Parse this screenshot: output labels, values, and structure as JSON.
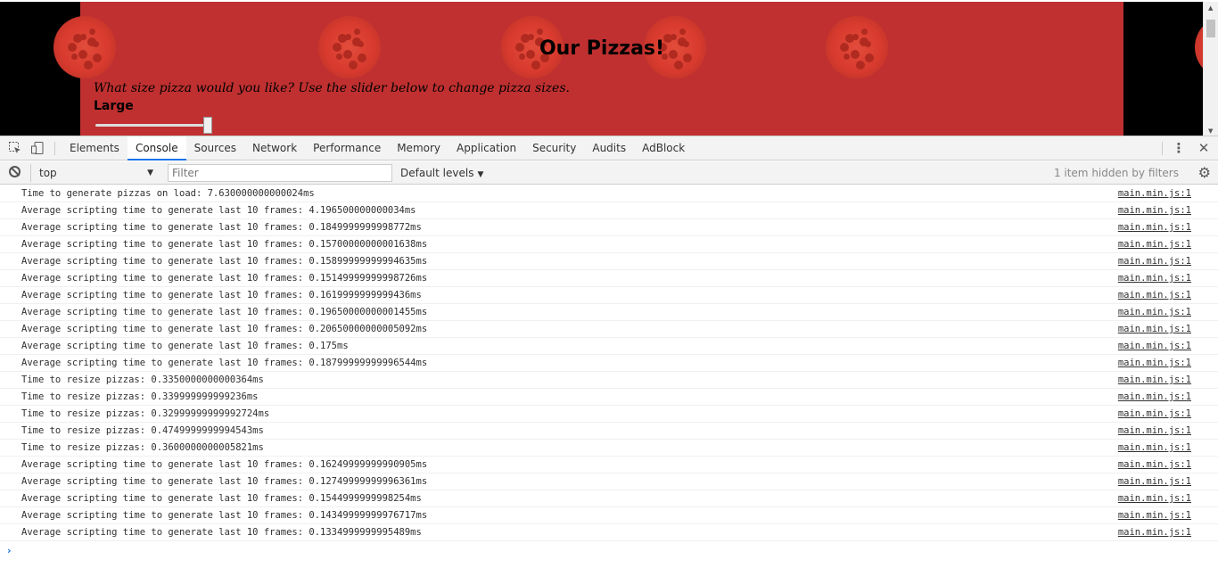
{
  "page": {
    "title": "Our Pizzas!",
    "question": "What size pizza would you like? Use the slider below to change pizza sizes.",
    "size_label": "Large",
    "slider_level": 1.0
  },
  "devtools": {
    "tabs": [
      {
        "label": "Elements"
      },
      {
        "label": "Console"
      },
      {
        "label": "Sources"
      },
      {
        "label": "Network"
      },
      {
        "label": "Performance"
      },
      {
        "label": "Memory"
      },
      {
        "label": "Application"
      },
      {
        "label": "Security"
      },
      {
        "label": "Audits"
      },
      {
        "label": "AdBlock"
      }
    ],
    "active_tab": "Console",
    "icons": {
      "inspect": "inspect-element-icon",
      "device": "device-toolbar-icon",
      "more": "more-vertical-icon",
      "close": "close-icon"
    },
    "filterbar": {
      "context": "top",
      "filter_placeholder": "Filter",
      "levels": "Default levels",
      "hidden": "1 item hidden by filters"
    },
    "console": {
      "messages": [
        {
          "text": "Time to generate pizzas on load: 7.630000000000024ms",
          "source": "main.min.js:1"
        },
        {
          "text": "Average scripting time to generate last 10 frames: 4.196500000000034ms",
          "source": "main.min.js:1"
        },
        {
          "text": "Average scripting time to generate last 10 frames: 0.1849999999998772ms",
          "source": "main.min.js:1"
        },
        {
          "text": "Average scripting time to generate last 10 frames: 0.15700000000001638ms",
          "source": "main.min.js:1"
        },
        {
          "text": "Average scripting time to generate last 10 frames: 0.15899999999994635ms",
          "source": "main.min.js:1"
        },
        {
          "text": "Average scripting time to generate last 10 frames: 0.15149999999998726ms",
          "source": "main.min.js:1"
        },
        {
          "text": "Average scripting time to generate last 10 frames: 0.1619999999999436ms",
          "source": "main.min.js:1"
        },
        {
          "text": "Average scripting time to generate last 10 frames: 0.19650000000001455ms",
          "source": "main.min.js:1"
        },
        {
          "text": "Average scripting time to generate last 10 frames: 0.20650000000005092ms",
          "source": "main.min.js:1"
        },
        {
          "text": "Average scripting time to generate last 10 frames: 0.175ms",
          "source": "main.min.js:1"
        },
        {
          "text": "Average scripting time to generate last 10 frames: 0.18799999999996544ms",
          "source": "main.min.js:1"
        },
        {
          "text": "Time to resize pizzas: 0.3350000000000364ms",
          "source": "main.min.js:1"
        },
        {
          "text": "Time to resize pizzas: 0.339999999999236ms",
          "source": "main.min.js:1"
        },
        {
          "text": "Time to resize pizzas: 0.32999999999992724ms",
          "source": "main.min.js:1"
        },
        {
          "text": "Time to resize pizzas: 0.4749999999994543ms",
          "source": "main.min.js:1"
        },
        {
          "text": "Time to resize pizzas: 0.3600000000005821ms",
          "source": "main.min.js:1"
        },
        {
          "text": "Average scripting time to generate last 10 frames: 0.16249999999990905ms",
          "source": "main.min.js:1"
        },
        {
          "text": "Average scripting time to generate last 10 frames: 0.12749999999996361ms",
          "source": "main.min.js:1"
        },
        {
          "text": "Average scripting time to generate last 10 frames: 0.1544999999998254ms",
          "source": "main.min.js:1"
        },
        {
          "text": "Average scripting time to generate last 10 frames: 0.14349999999976717ms",
          "source": "main.min.js:1"
        },
        {
          "text": "Average scripting time to generate last 10 frames: 0.1334999999995489ms",
          "source": "main.min.js:1"
        }
      ],
      "prompt_symbol": "›"
    }
  }
}
